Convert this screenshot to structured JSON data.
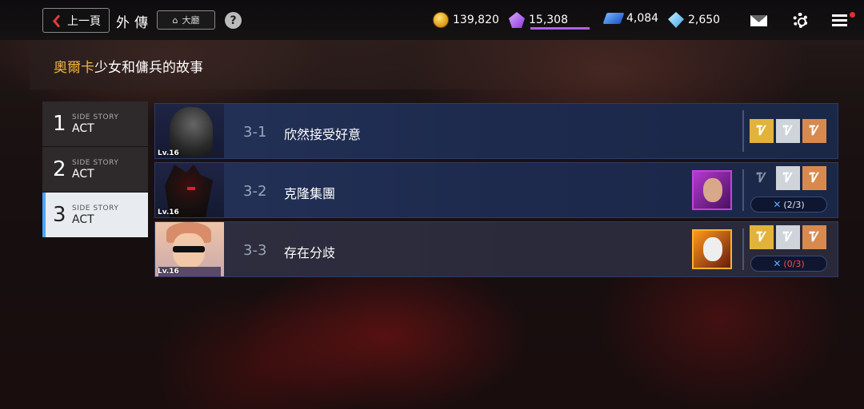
{
  "header": {
    "back_label": "上一頁",
    "page_title": "外傳",
    "lobby_label": "大廳",
    "help_label": "?"
  },
  "resources": [
    {
      "icon": "gold-coin-icon",
      "value": "139,820"
    },
    {
      "icon": "purple-gem-icon",
      "value": "15,308"
    },
    {
      "icon": "ticket-icon",
      "value": "4,084"
    },
    {
      "icon": "diamond-icon",
      "value": "2,650"
    }
  ],
  "story": {
    "title_highlight": "奧爾卡",
    "title_rest": "少女和傭兵的故事"
  },
  "acts": [
    {
      "num": "1",
      "sub": "SIDE STORY",
      "label": "ACT"
    },
    {
      "num": "2",
      "sub": "SIDE STORY",
      "label": "ACT"
    },
    {
      "num": "3",
      "sub": "SIDE STORY",
      "label": "ACT"
    }
  ],
  "levels": [
    {
      "lv": "Lv.16",
      "code": "3-1",
      "name": "欣然接受好意",
      "counter": ""
    },
    {
      "lv": "Lv.16",
      "code": "3-2",
      "name": "克隆集團",
      "counter": "(2/3)"
    },
    {
      "lv": "Lv.16",
      "code": "3-3",
      "name": "存在分歧",
      "counter": "(0/3)"
    }
  ],
  "colors": {
    "accent_gold": "#f1b43a",
    "active_tab": "#4aa6ff",
    "purple_bar": "#b45cff"
  }
}
